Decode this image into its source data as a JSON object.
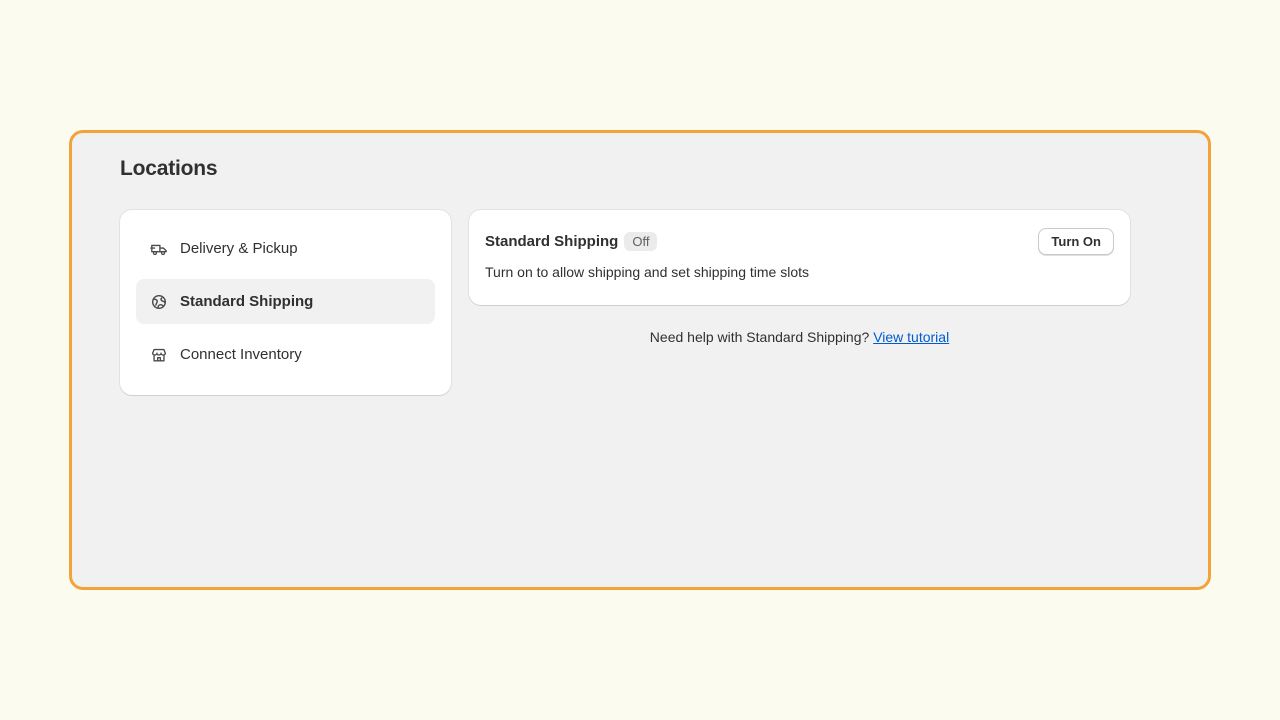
{
  "page": {
    "title": "Locations"
  },
  "colors": {
    "frame_border": "#f2a33a",
    "link": "#005bd3"
  },
  "nav": {
    "items": [
      {
        "label": "Delivery & Pickup",
        "icon": "delivery-truck-icon",
        "active": false
      },
      {
        "label": "Standard Shipping",
        "icon": "globe-shipping-icon",
        "active": true
      },
      {
        "label": "Connect Inventory",
        "icon": "store-icon",
        "active": false
      }
    ]
  },
  "detail": {
    "title": "Standard Shipping",
    "status_badge": "Off",
    "action_button": "Turn On",
    "description": "Turn on to allow shipping and set shipping time slots"
  },
  "help": {
    "text": "Need help with Standard Shipping?",
    "link": "View tutorial"
  }
}
